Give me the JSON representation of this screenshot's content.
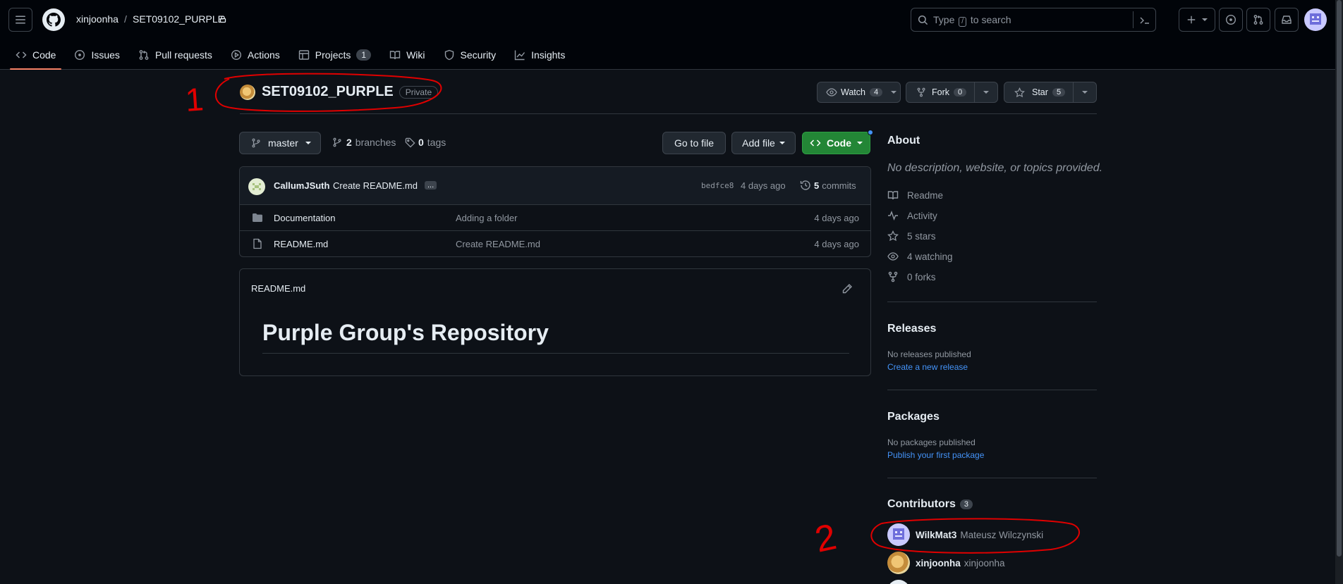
{
  "header": {
    "owner": "xinjoonha",
    "separator": "/",
    "repo": "SET09102_PURPLE",
    "search": {
      "prefix": "Type",
      "key": "/",
      "suffix": "to search"
    }
  },
  "tabs": [
    {
      "label": "Code",
      "icon": "code-icon",
      "active": true
    },
    {
      "label": "Issues",
      "icon": "issue-icon"
    },
    {
      "label": "Pull requests",
      "icon": "pull-request-icon"
    },
    {
      "label": "Actions",
      "icon": "play-icon"
    },
    {
      "label": "Projects",
      "icon": "table-icon",
      "count": "1"
    },
    {
      "label": "Wiki",
      "icon": "book-icon"
    },
    {
      "label": "Security",
      "icon": "shield-icon"
    },
    {
      "label": "Insights",
      "icon": "graph-icon"
    }
  ],
  "repo": {
    "name": "SET09102_PURPLE",
    "visibility": "Private",
    "watch_label": "Watch",
    "watch_count": "4",
    "fork_label": "Fork",
    "fork_count": "0",
    "star_label": "Star",
    "star_count": "5"
  },
  "filenav": {
    "branch": "master",
    "branches_count": "2",
    "branches_label": "branches",
    "tags_count": "0",
    "tags_label": "tags",
    "goto_file": "Go to file",
    "add_file": "Add file",
    "code": "Code"
  },
  "commit": {
    "author": "CallumJSuth",
    "message": "Create README.md",
    "more": "...",
    "sha": "bedfce8",
    "time": "4 days ago",
    "commits_count": "5",
    "commits_label": "commits"
  },
  "files": [
    {
      "type": "folder",
      "name": "Documentation",
      "message": "Adding a folder",
      "date": "4 days ago"
    },
    {
      "type": "file",
      "name": "README.md",
      "message": "Create README.md",
      "date": "4 days ago"
    }
  ],
  "readme": {
    "filename": "README.md",
    "heading": "Purple Group's Repository"
  },
  "about": {
    "title": "About",
    "description": "No description, website, or topics provided.",
    "items": [
      {
        "icon": "book-icon",
        "label": "Readme"
      },
      {
        "icon": "pulse-icon",
        "label": "Activity"
      },
      {
        "icon": "star-icon",
        "label": "5 stars"
      },
      {
        "icon": "eye-icon",
        "label": "4 watching"
      },
      {
        "icon": "fork-icon",
        "label": "0 forks"
      }
    ]
  },
  "releases": {
    "title": "Releases",
    "empty": "No releases published",
    "link": "Create a new release"
  },
  "packages": {
    "title": "Packages",
    "empty": "No packages published",
    "link": "Publish your first package"
  },
  "contributors": {
    "title": "Contributors",
    "count": "3",
    "list": [
      {
        "login": "WilkMat3",
        "name": "Mateusz Wilczynski"
      },
      {
        "login": "xinjoonha",
        "name": "xinjoonha"
      }
    ]
  },
  "annotations": {
    "one": "1",
    "two": "2"
  },
  "colors": {
    "accent_tab": "#f78166",
    "green": "#238636",
    "link": "#4493f8",
    "annotation": "#e00000"
  }
}
